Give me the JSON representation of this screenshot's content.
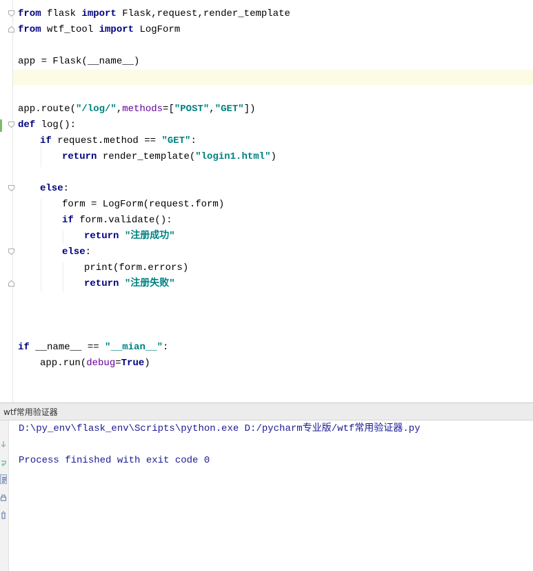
{
  "editor": {
    "lines": {
      "l1": {
        "k1": "from",
        "t1": " flask ",
        "k2": "import",
        "t2": " Flask,request,render_template"
      },
      "l2": {
        "k1": "from",
        "t1": " wtf_tool ",
        "k2": "import",
        "t2": " LogForm"
      },
      "l4": {
        "t1": "app = Flask(__name__)"
      },
      "l7": {
        "t1": "app.route(",
        "s1": "\"/log/\"",
        "t2": ",",
        "a1": "methods",
        "t3": "=[",
        "s2": "\"POST\"",
        "t4": ",",
        "s3": "\"GET\"",
        "t5": "])"
      },
      "l8": {
        "k1": "def",
        "t1": " log():"
      },
      "l9": {
        "k1": "if",
        "t1": " request.method == ",
        "s1": "\"GET\"",
        "t2": ":"
      },
      "l10": {
        "k1": "return",
        "t1": " render_template(",
        "s1": "\"login1.html\"",
        "t2": ")"
      },
      "l12": {
        "k1": "else",
        "t1": ":"
      },
      "l13": {
        "t1": "form = LogForm(request.form)"
      },
      "l14": {
        "k1": "if",
        "t1": " form.validate():"
      },
      "l15": {
        "k1": "return",
        "t1": " ",
        "s1": "\"注册成功\""
      },
      "l16": {
        "k1": "else",
        "t1": ":"
      },
      "l17": {
        "t1": "print(form.errors)"
      },
      "l18": {
        "k1": "return",
        "t1": " ",
        "s1": "\"注册失败\""
      },
      "l22": {
        "k1": "if",
        "t1": " __name__ == ",
        "s1": "\"__mian__\"",
        "t2": ":"
      },
      "l23": {
        "t1": "app.run(",
        "a1": "debug",
        "t2": "=",
        "k1": "True",
        "t3": ")"
      }
    }
  },
  "tool_window": {
    "title": "wtf常用验证器"
  },
  "console": {
    "command": "D:\\py_env\\flask_env\\Scripts\\python.exe D:/pycharm专业版/wtf常用验证器.py",
    "exit_message": "Process finished with exit code 0"
  },
  "colors": {
    "keyword": "#000080",
    "string": "#008080",
    "kwarg": "#660099",
    "caret_row": "#fdfae6",
    "console_text": "#1a1a96"
  }
}
